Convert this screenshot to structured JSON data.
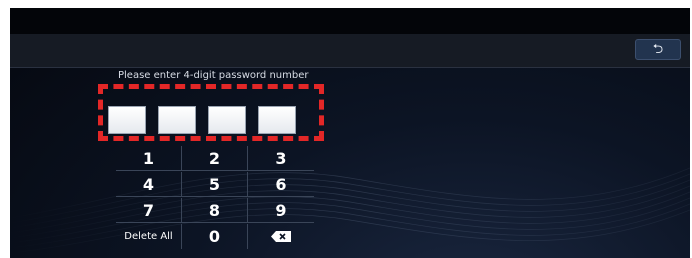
{
  "header": {
    "back_icon": "return-arrow-icon"
  },
  "password_entry": {
    "prompt": "Please enter 4-digit password number",
    "digit_count": 4,
    "entered_digits": [
      "",
      "",
      "",
      ""
    ],
    "highlight_color": "#e32727"
  },
  "keypad": {
    "keys": [
      "1",
      "2",
      "3",
      "4",
      "5",
      "6",
      "7",
      "8",
      "9",
      "Delete All",
      "0",
      "backspace-icon"
    ]
  },
  "colors": {
    "background": "#0c1424",
    "header_bar": "#161b24",
    "button_accent": "#22344f",
    "text": "#ffffff"
  }
}
